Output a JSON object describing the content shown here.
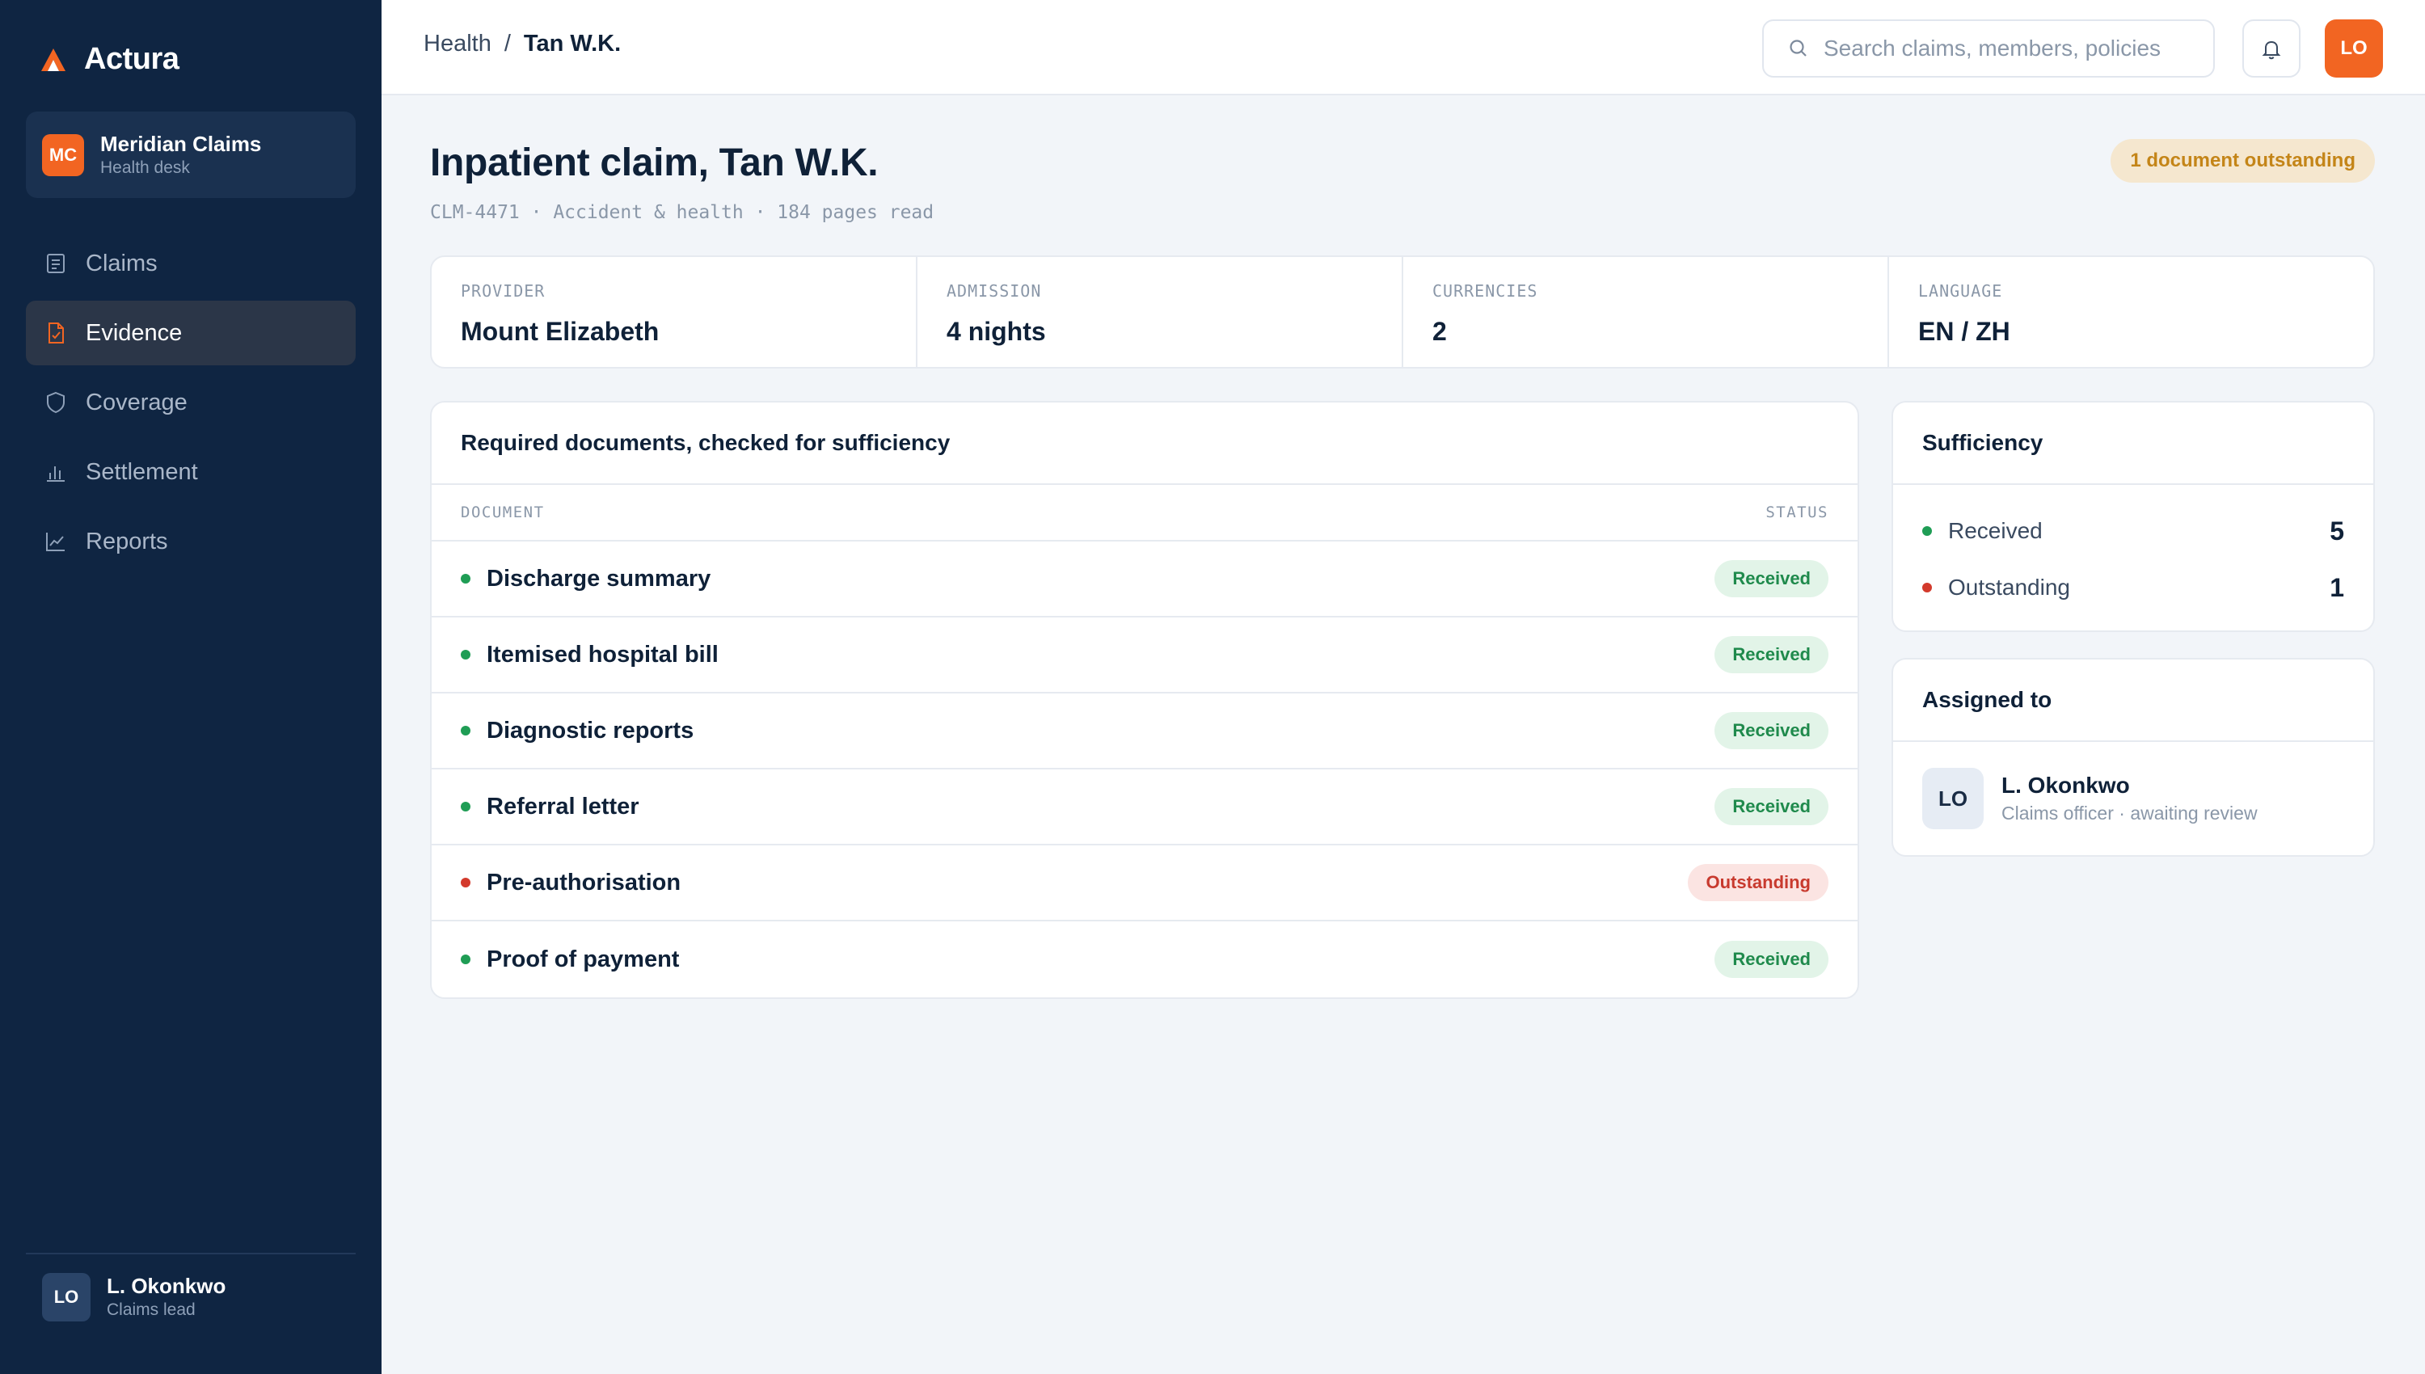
{
  "brand": {
    "name": "Actura"
  },
  "org": {
    "initials": "MC",
    "name": "Meridian Claims",
    "subtitle": "Health desk"
  },
  "nav": {
    "items": [
      {
        "label": "Claims",
        "icon": "document-icon",
        "active": false
      },
      {
        "label": "Evidence",
        "icon": "file-check-icon",
        "active": true
      },
      {
        "label": "Coverage",
        "icon": "shield-icon",
        "active": false
      },
      {
        "label": "Settlement",
        "icon": "bar-chart-icon",
        "active": false
      },
      {
        "label": "Reports",
        "icon": "line-chart-icon",
        "active": false
      }
    ]
  },
  "user": {
    "initials": "LO",
    "name": "L. Okonkwo",
    "role": "Claims lead"
  },
  "topbar": {
    "breadcrumb": {
      "parent": "Health",
      "separator": "/",
      "current": "Tan W.K."
    },
    "search_placeholder": "Search claims, members, policies",
    "avatar_initials": "LO"
  },
  "header": {
    "title": "Inpatient claim, Tan W.K.",
    "meta": "CLM-4471 · Accident & health · 184 pages read",
    "status_pill": "1 document outstanding"
  },
  "stats": [
    {
      "label": "PROVIDER",
      "value": "Mount Elizabeth"
    },
    {
      "label": "ADMISSION",
      "value": "4 nights"
    },
    {
      "label": "CURRENCIES",
      "value": "2"
    },
    {
      "label": "LANGUAGE",
      "value": "EN / ZH"
    }
  ],
  "documents": {
    "title": "Required documents, checked for sufficiency",
    "columns": {
      "document": "DOCUMENT",
      "status": "STATUS"
    },
    "rows": [
      {
        "name": "Discharge summary",
        "status": "Received"
      },
      {
        "name": "Itemised hospital bill",
        "status": "Received"
      },
      {
        "name": "Diagnostic reports",
        "status": "Received"
      },
      {
        "name": "Referral letter",
        "status": "Received"
      },
      {
        "name": "Pre-authorisation",
        "status": "Outstanding"
      },
      {
        "name": "Proof of payment",
        "status": "Received"
      }
    ]
  },
  "sufficiency": {
    "title": "Sufficiency",
    "received_label": "Received",
    "received_count": "5",
    "outstanding_label": "Outstanding",
    "outstanding_count": "1"
  },
  "assigned": {
    "title": "Assigned to",
    "initials": "LO",
    "name": "L. Okonkwo",
    "role": "Claims officer · awaiting review"
  },
  "colors": {
    "sidebar": "#0f2542",
    "accent": "#f26522",
    "received": "#1f9d55",
    "outstanding": "#d33a2c"
  }
}
